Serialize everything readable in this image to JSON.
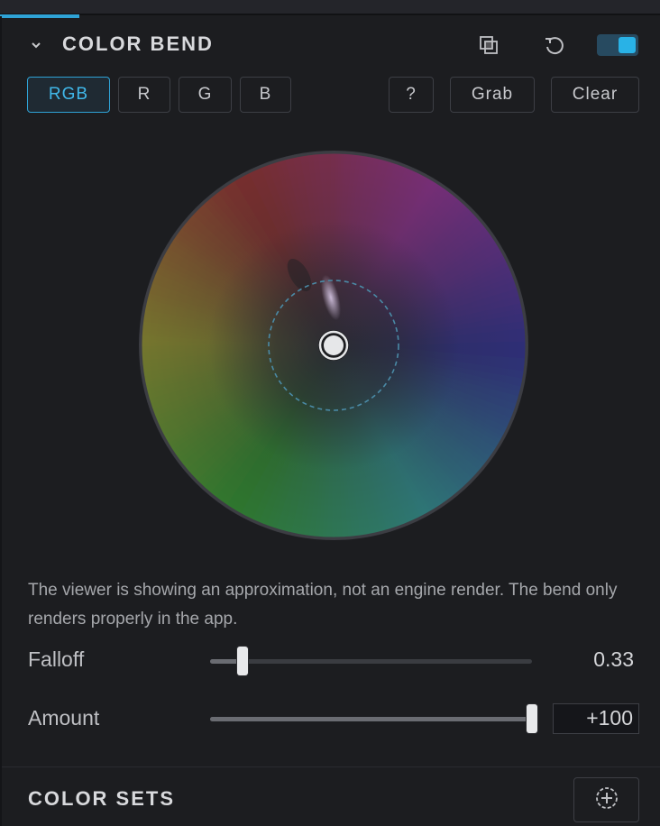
{
  "section": {
    "title": "COLOR BEND",
    "collapse_icon": "chevron-down-icon",
    "toolbar_icons": [
      "copy-layers-icon",
      "reset-icon"
    ],
    "enabled": true
  },
  "channel_tabs": [
    {
      "label": "RGB",
      "active": true
    },
    {
      "label": "R",
      "active": false
    },
    {
      "label": "G",
      "active": false
    },
    {
      "label": "B",
      "active": false
    }
  ],
  "actions": {
    "help": "?",
    "grab": "Grab",
    "clear": "Clear"
  },
  "note": "The viewer is showing an approximation, not an engine render. The bend only renders properly in the app.",
  "sliders": {
    "falloff": {
      "label": "Falloff",
      "value": "0.33",
      "fraction": 0.1
    },
    "amount": {
      "label": "Amount",
      "value": "+100",
      "fraction": 1.0
    }
  },
  "color_sets": {
    "title": "COLOR SETS",
    "add_icon": "add-circle-icon"
  },
  "colors": {
    "accent": "#2fa3d6",
    "background": "#1c1d20"
  }
}
